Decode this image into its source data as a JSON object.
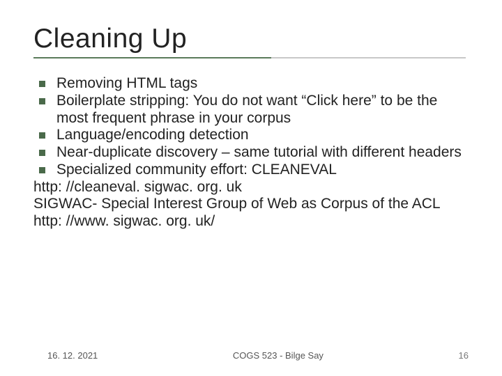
{
  "title": "Cleaning Up",
  "bullets": [
    "Removing HTML tags",
    "Boilerplate stripping: You do not want “Click here” to be the most frequent phrase in your corpus",
    "Language/encoding detection",
    "Near-duplicate discovery – same tutorial with different headers",
    "Specialized community effort: CLEANEVAL"
  ],
  "lines": [
    "http: //cleaneval. sigwac. org. uk",
    "SIGWAC- Special Interest Group of Web as Corpus of the ACL",
    "http: //www. sigwac. org. uk/"
  ],
  "footer": {
    "date": "16. 12. 2021",
    "center": "COGS 523 - Bilge Say",
    "page": "16"
  }
}
